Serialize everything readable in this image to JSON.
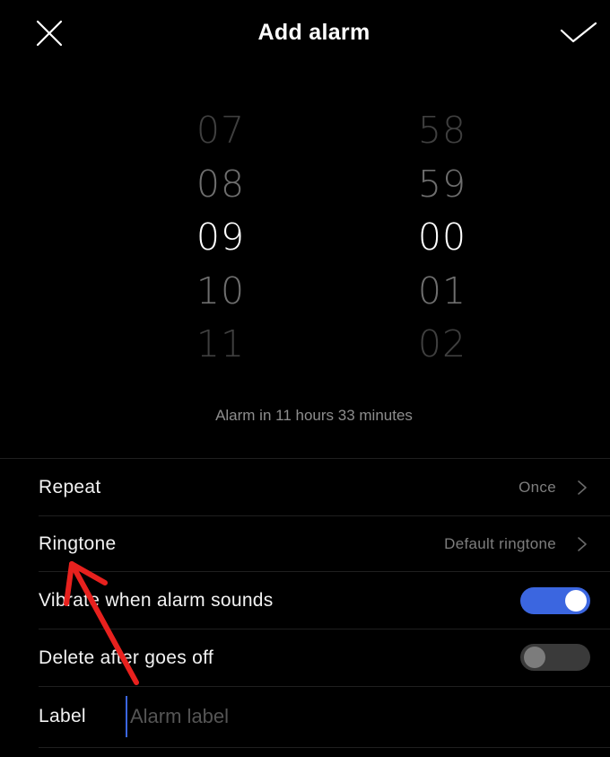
{
  "header": {
    "title": "Add alarm",
    "close_icon": "close-icon",
    "confirm_icon": "check-icon"
  },
  "picker": {
    "hours": [
      "07",
      "08",
      "09",
      "10",
      "11"
    ],
    "minutes": [
      "58",
      "59",
      "00",
      "01",
      "02"
    ],
    "selected_hour": "09",
    "selected_minute": "00"
  },
  "remaining_text": "Alarm in 11 hours 33 minutes",
  "settings": {
    "repeat": {
      "label": "Repeat",
      "value": "Once"
    },
    "ringtone": {
      "label": "Ringtone",
      "value": "Default ringtone"
    },
    "vibrate": {
      "label": "Vibrate when alarm sounds",
      "enabled": true
    },
    "delete_after": {
      "label": "Delete after goes off",
      "enabled": false
    },
    "label_field": {
      "label": "Label",
      "placeholder": "Alarm label",
      "value": ""
    }
  },
  "annotation": {
    "arrow_color": "#e8211e"
  },
  "colors": {
    "background": "#000000",
    "accent": "#3b66e0",
    "toggle_off": "#3a3a3a"
  }
}
